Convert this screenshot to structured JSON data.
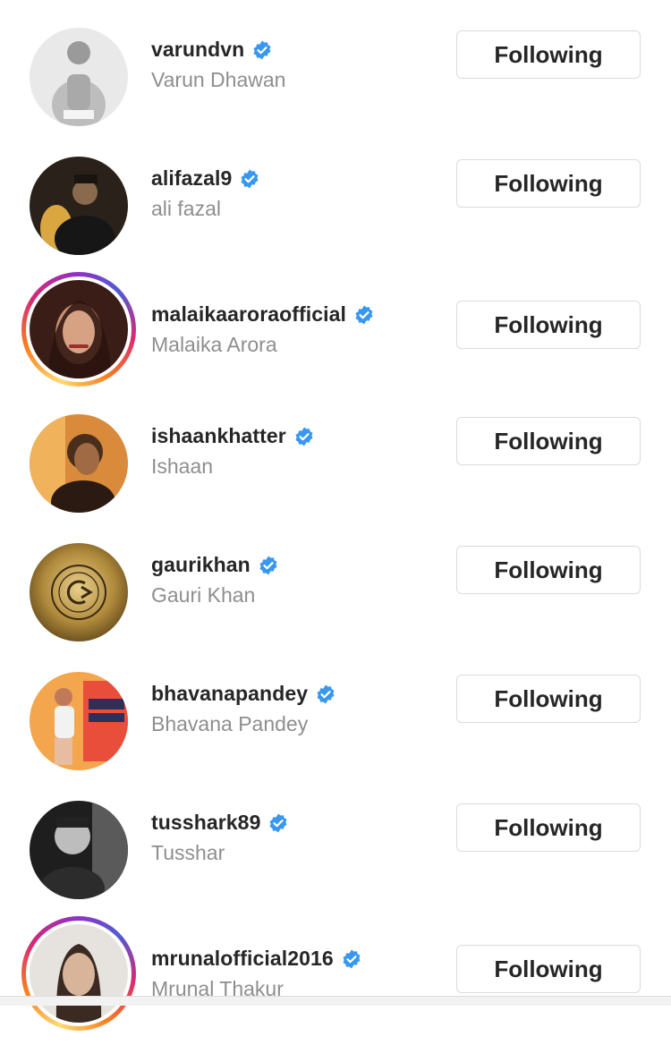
{
  "accounts": [
    {
      "username": "varundvn",
      "full_name": "Varun Dhawan",
      "button_label": "Following",
      "verified": true,
      "story_ring": false
    },
    {
      "username": "alifazal9",
      "full_name": "ali fazal",
      "button_label": "Following",
      "verified": true,
      "story_ring": false
    },
    {
      "username": "malaikaaroraofficial",
      "full_name": "Malaika Arora",
      "button_label": "Following",
      "verified": true,
      "story_ring": true
    },
    {
      "username": "ishaankhatter",
      "full_name": "Ishaan",
      "button_label": "Following",
      "verified": true,
      "story_ring": false
    },
    {
      "username": "gaurikhan",
      "full_name": "Gauri Khan",
      "button_label": "Following",
      "verified": true,
      "story_ring": false
    },
    {
      "username": "bhavanapandey",
      "full_name": "Bhavana Pandey",
      "button_label": "Following",
      "verified": true,
      "story_ring": false
    },
    {
      "username": "tusshark89",
      "full_name": "Tusshar",
      "button_label": "Following",
      "verified": true,
      "story_ring": false
    },
    {
      "username": "mrunalofficial2016",
      "full_name": "Mrunal Thakur",
      "button_label": "Following",
      "verified": true,
      "story_ring": true
    }
  ],
  "colors": {
    "verified_blue": "#3897f0",
    "username_text": "#262626",
    "fullname_text": "#8e8e8e",
    "button_border": "#dbdbdb"
  },
  "icons": {
    "verified": "verified-badge-icon"
  }
}
